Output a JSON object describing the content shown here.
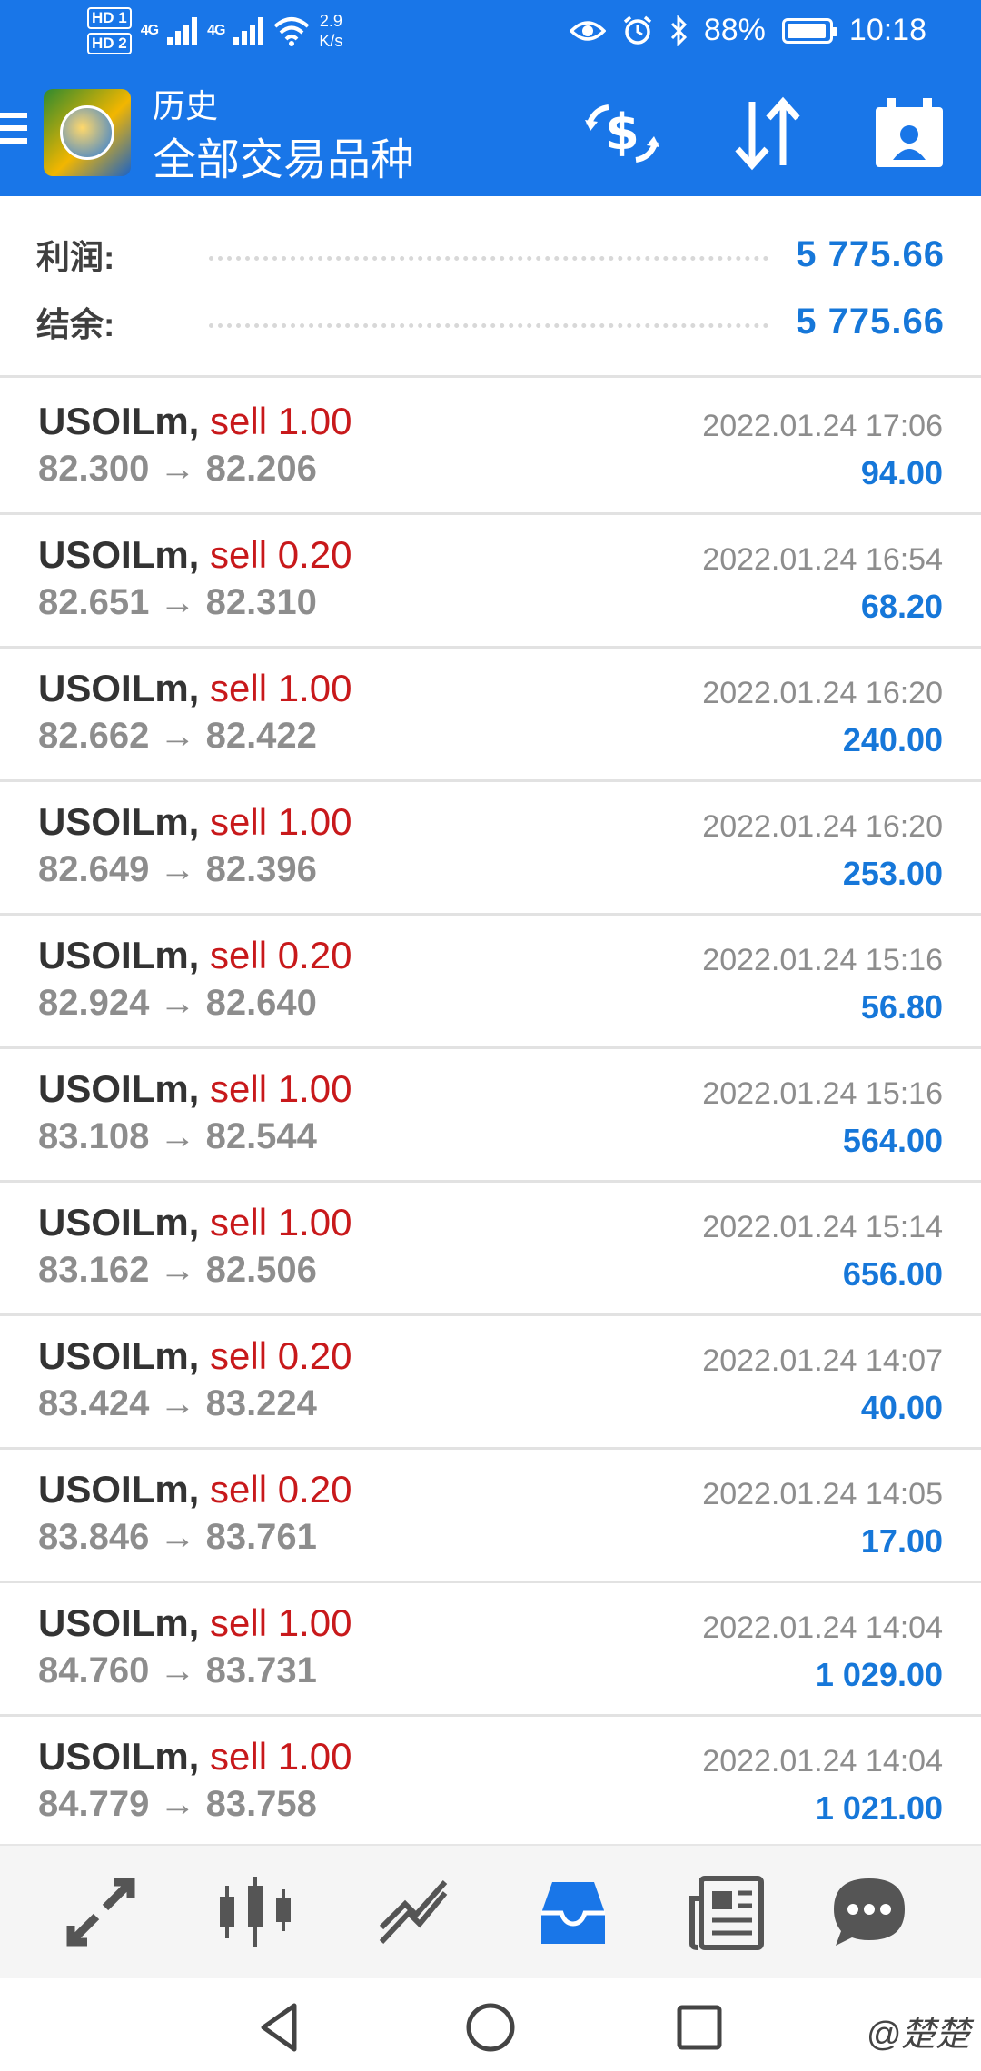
{
  "status_bar": {
    "hd1": "HD 1",
    "hd2": "HD 2",
    "net1": "4G",
    "net2": "4G",
    "speed": "2.9",
    "speed_unit": "K/s",
    "battery": "88%",
    "time": "10:18"
  },
  "header": {
    "title": "历史",
    "subtitle": "全部交易品种"
  },
  "summary": {
    "profit_label": "利润:",
    "profit_value": "5 775.66",
    "balance_label": "结余:",
    "balance_value": "5 775.66"
  },
  "trades": [
    {
      "symbol": "USOILm,",
      "side": "sell 1.00",
      "prices": "82.300 → 82.206",
      "time": "2022.01.24 17:06",
      "profit": "94.00"
    },
    {
      "symbol": "USOILm,",
      "side": "sell 0.20",
      "prices": "82.651 → 82.310",
      "time": "2022.01.24 16:54",
      "profit": "68.20"
    },
    {
      "symbol": "USOILm,",
      "side": "sell 1.00",
      "prices": "82.662 → 82.422",
      "time": "2022.01.24 16:20",
      "profit": "240.00"
    },
    {
      "symbol": "USOILm,",
      "side": "sell 1.00",
      "prices": "82.649 → 82.396",
      "time": "2022.01.24 16:20",
      "profit": "253.00"
    },
    {
      "symbol": "USOILm,",
      "side": "sell 0.20",
      "prices": "82.924 → 82.640",
      "time": "2022.01.24 15:16",
      "profit": "56.80"
    },
    {
      "symbol": "USOILm,",
      "side": "sell 1.00",
      "prices": "83.108 → 82.544",
      "time": "2022.01.24 15:16",
      "profit": "564.00"
    },
    {
      "symbol": "USOILm,",
      "side": "sell 1.00",
      "prices": "83.162 → 82.506",
      "time": "2022.01.24 15:14",
      "profit": "656.00"
    },
    {
      "symbol": "USOILm,",
      "side": "sell 0.20",
      "prices": "83.424 → 83.224",
      "time": "2022.01.24 14:07",
      "profit": "40.00"
    },
    {
      "symbol": "USOILm,",
      "side": "sell 0.20",
      "prices": "83.846 → 83.761",
      "time": "2022.01.24 14:05",
      "profit": "17.00"
    },
    {
      "symbol": "USOILm,",
      "side": "sell 1.00",
      "prices": "84.760 → 83.731",
      "time": "2022.01.24 14:04",
      "profit": "1 029.00"
    },
    {
      "symbol": "USOILm,",
      "side": "sell 1.00",
      "prices": "84.779 → 83.758",
      "time": "2022.01.24 14:04",
      "profit": "1 021.00"
    }
  ],
  "watermark": "@楚楚",
  "colors": {
    "accent": "#1976e8",
    "profit": "#1677d9",
    "sell": "#c8191b"
  }
}
